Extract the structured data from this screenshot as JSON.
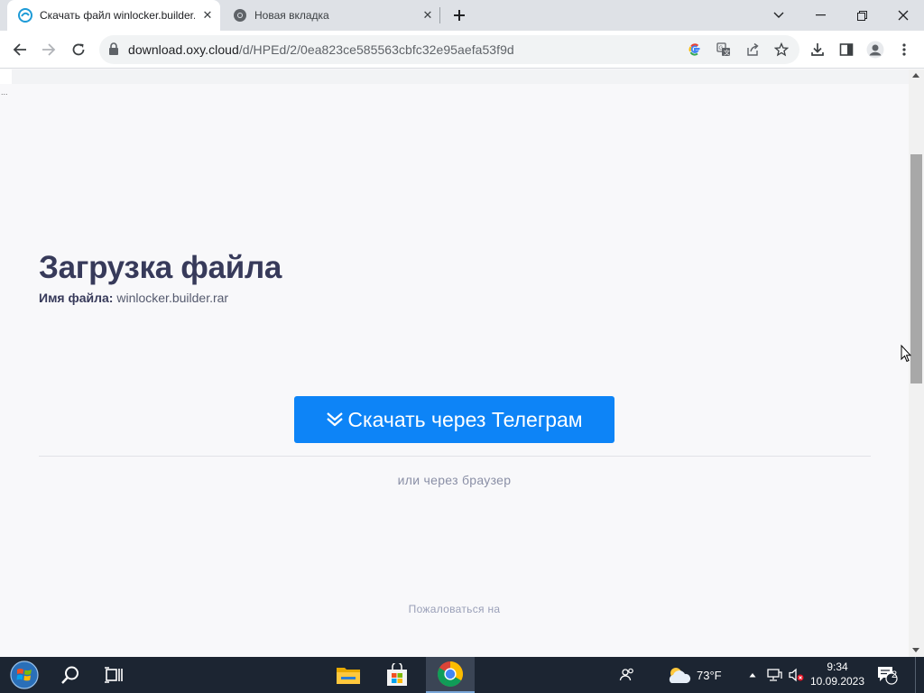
{
  "browser": {
    "tabs": [
      {
        "title": "Скачать файл winlocker.builder.r",
        "active": true,
        "icon": "oxy-cloud-icon"
      },
      {
        "title": "Новая вкладка",
        "active": false,
        "icon": "chrome-icon"
      }
    ],
    "omnibox": {
      "host": "download.oxy.cloud",
      "path": "/d/HPEd/2/0ea823ce585563cbfc32e95aefa53f9d"
    }
  },
  "page": {
    "heading": "Загрузка файла",
    "file_label": "Имя файла:",
    "file_name": "winlocker.builder.rar",
    "telegram_button": "Скачать через Телеграм",
    "alt_link": "или через браузер",
    "report_link": "Пожаловаться на",
    "dots": "..."
  },
  "taskbar": {
    "weather_temp": "73°F",
    "clock_time": "9:34",
    "clock_date": "10.09.2023",
    "notifications": "2"
  },
  "colors": {
    "accent": "#0d84f7",
    "heading": "#373a5a",
    "taskbar": "#1c2532"
  }
}
